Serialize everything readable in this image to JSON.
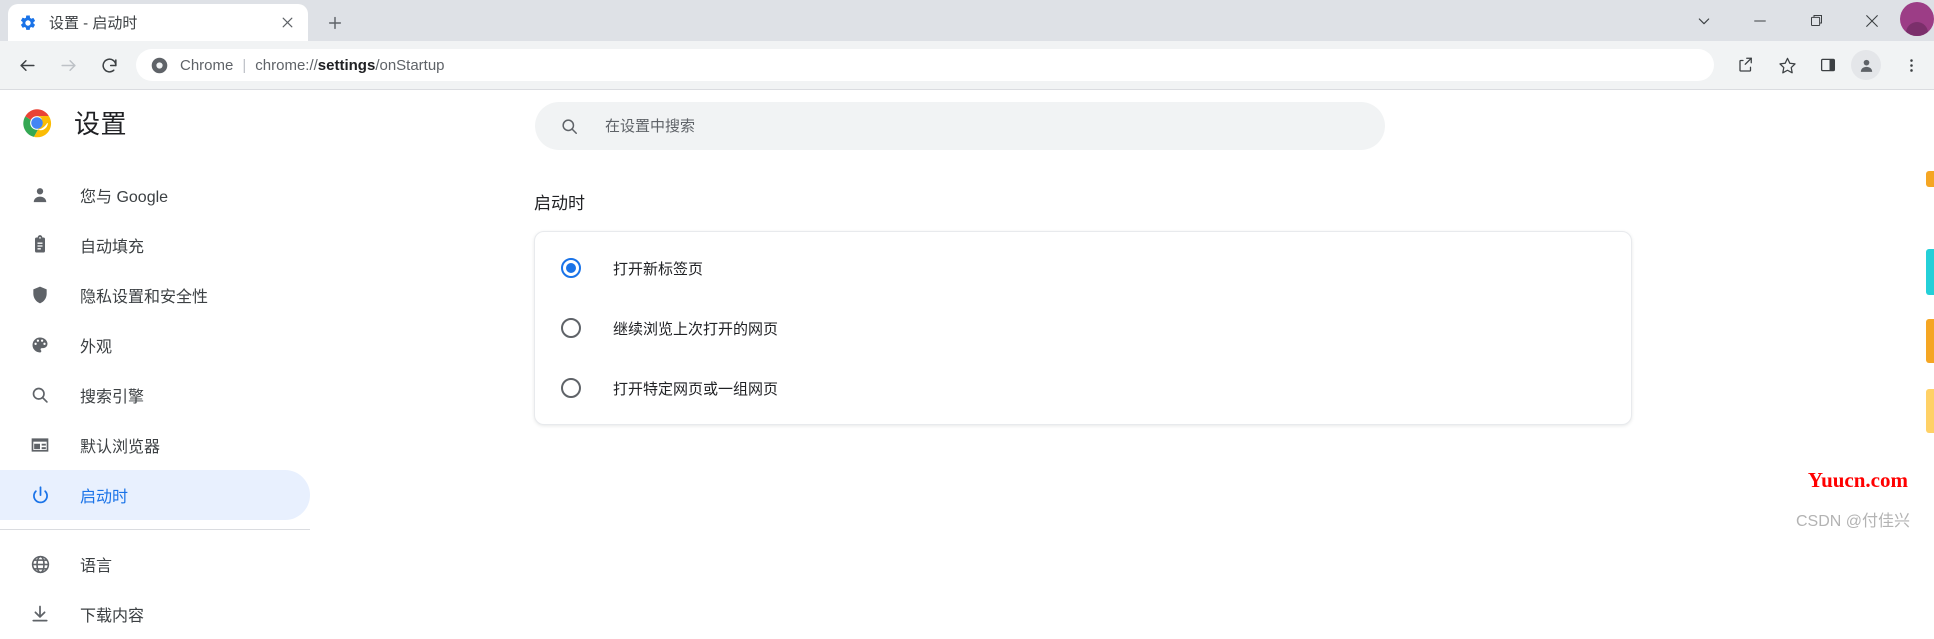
{
  "window": {
    "tab": {
      "title": "设置 - 启动时",
      "favicon": "settings-gear-icon",
      "close": "×"
    },
    "new_tab_label": "+",
    "controls": {
      "tab_search": "chevron-down-icon",
      "minimize": "minimize-icon",
      "maximize": "maximize-icon",
      "close": "close-icon"
    }
  },
  "toolbar": {
    "back": "back-arrow-icon",
    "forward": "forward-arrow-icon",
    "reload": "reload-icon",
    "omnibox": {
      "site_icon": "chrome-icon",
      "scheme_label": "Chrome",
      "separator": "|",
      "url_prefix": "chrome://",
      "url_bold": "settings",
      "url_suffix": "/onStartup",
      "full_url": "chrome://settings/onStartup"
    },
    "actions": {
      "share": "share-icon",
      "bookmark": "star-icon",
      "side_panel": "side-panel-icon",
      "profile": "profile-avatar-icon",
      "menu": "three-dot-menu-icon"
    }
  },
  "settings": {
    "brand_title": "设置",
    "brand_logo": "chrome-logo-icon",
    "search": {
      "placeholder": "在设置中搜索",
      "value": "",
      "icon": "search-icon"
    },
    "sidebar": {
      "items": [
        {
          "label": "您与 Google",
          "icon": "person-icon",
          "active": false
        },
        {
          "label": "自动填充",
          "icon": "clipboard-icon",
          "active": false
        },
        {
          "label": "隐私设置和安全性",
          "icon": "shield-icon",
          "active": false
        },
        {
          "label": "外观",
          "icon": "palette-icon",
          "active": false
        },
        {
          "label": "搜索引擎",
          "icon": "search-icon",
          "active": false
        },
        {
          "label": "默认浏览器",
          "icon": "browser-window-icon",
          "active": false
        },
        {
          "label": "启动时",
          "icon": "power-icon",
          "active": true
        }
      ],
      "items_after_divider": [
        {
          "label": "语言",
          "icon": "globe-icon",
          "active": false
        },
        {
          "label": "下载内容",
          "icon": "download-icon",
          "active": false
        }
      ]
    },
    "main": {
      "section_title": "启动时",
      "startup_options": [
        {
          "label": "打开新标签页",
          "checked": true
        },
        {
          "label": "继续浏览上次打开的网页",
          "checked": false
        },
        {
          "label": "打开特定网页或一组网页",
          "checked": false
        }
      ]
    }
  },
  "watermarks": {
    "primary": "Yuucn.com",
    "secondary": "CSDN @付佳兴"
  },
  "colors": {
    "accent": "#1a73e8",
    "active_bg": "#e8f0fe",
    "tabstrip_bg": "#dee1e6",
    "toolbar_bg": "#f1f3f4",
    "text_primary": "#202124",
    "text_secondary": "#5f6368",
    "watermark_red": "#ff0000"
  }
}
